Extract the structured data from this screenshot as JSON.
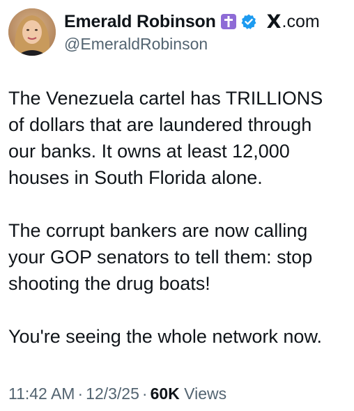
{
  "author": {
    "display_name": "Emerald Robinson",
    "handle": "@EmeraldRobinson",
    "badges": [
      "cross-icon",
      "verified-icon"
    ],
    "avatar_icon": "profile-photo"
  },
  "site": {
    "logo": "X",
    "label": ".com"
  },
  "tweet": {
    "paragraphs": [
      "The Venezuela cartel has TRILLIONS\nof dollars that are laundered through\nour banks. It owns at least 12,000\nhouses in South Florida alone.",
      "The corrupt bankers are now calling\nyour GOP senators to tell them: stop\nshooting the drug boats!",
      "You're seeing the whole network now."
    ]
  },
  "meta": {
    "time": "11:42 AM",
    "separator": "·",
    "date": "12/3/25",
    "views_count": "60K",
    "views_label": "Views"
  },
  "colors": {
    "text_primary": "#0f1419",
    "text_secondary": "#536471",
    "verified_blue": "#1d9bf0",
    "cross_badge_purple": "#8e6bd6"
  }
}
